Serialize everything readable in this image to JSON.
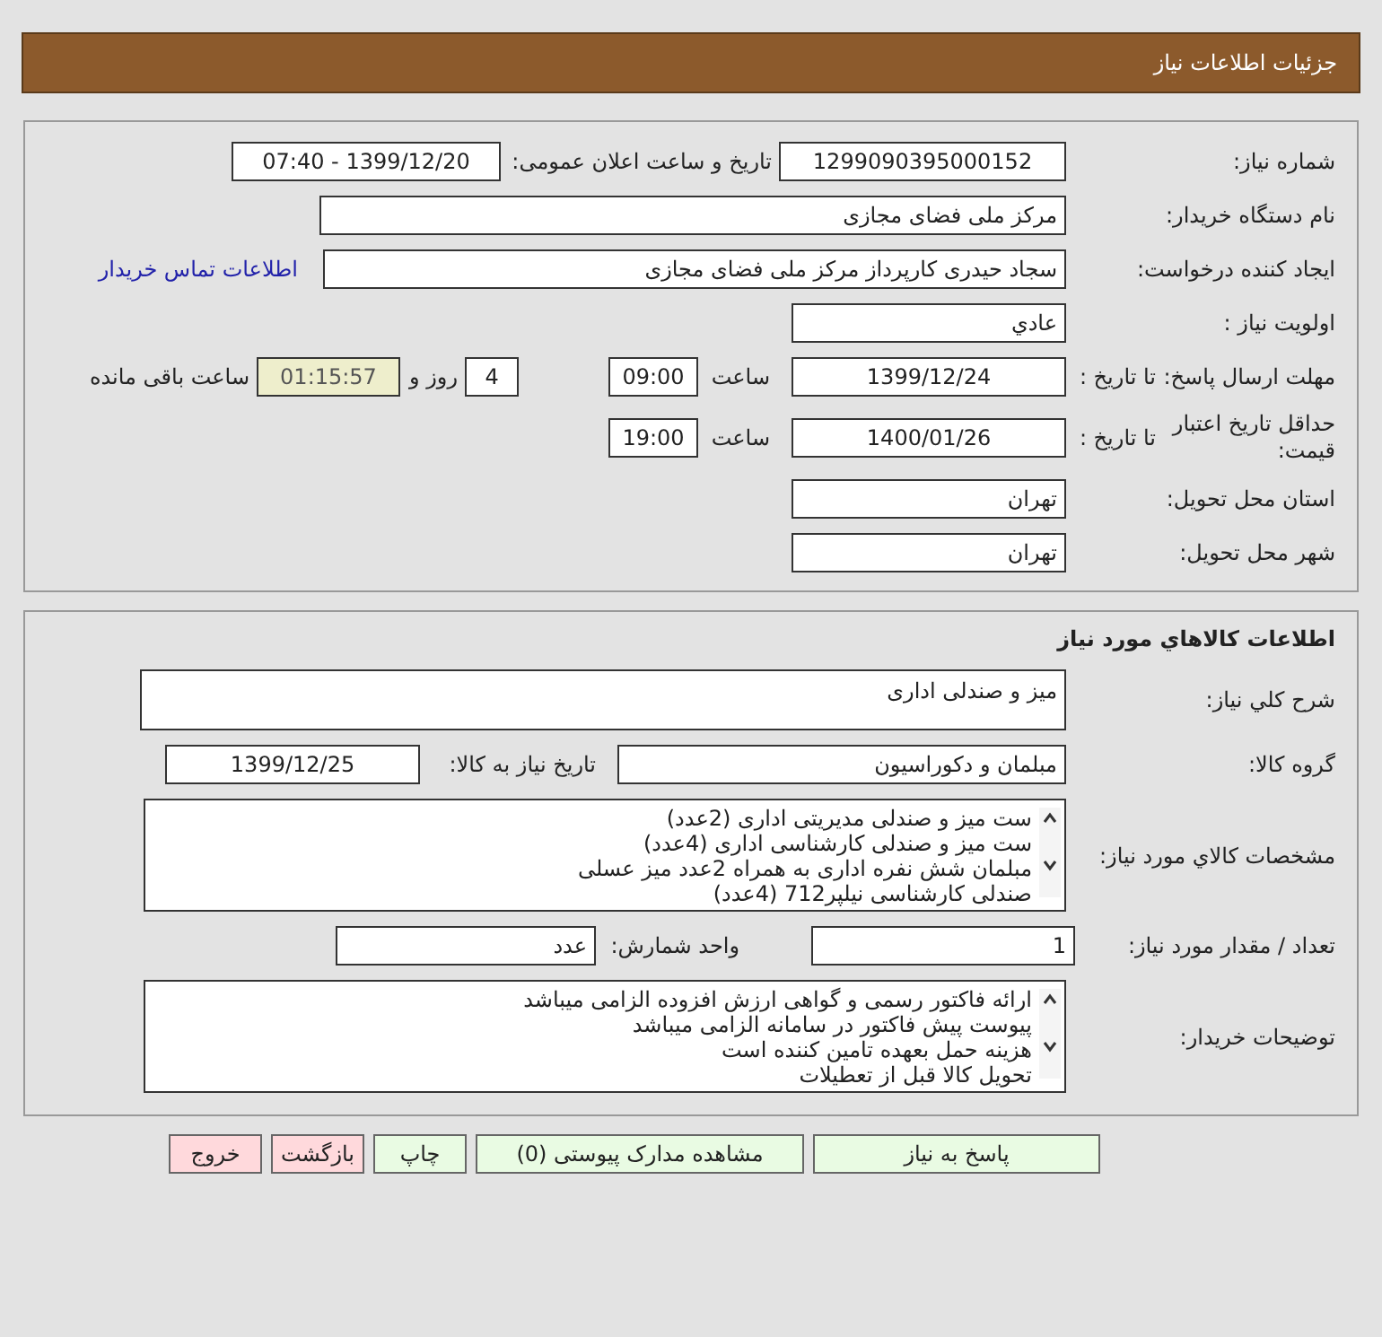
{
  "header": {
    "title": "جزئیات اطلاعات نیاز"
  },
  "request": {
    "number": {
      "label": "شماره نیاز:",
      "value": "1299090395000152"
    },
    "announce": {
      "label": "تاریخ و ساعت اعلان عمومی:",
      "value": "1399/12/20 - 07:40"
    },
    "buyer": {
      "label": "نام دستگاه خریدار:",
      "value": "مرکز ملی فضای مجازی"
    },
    "creator": {
      "label": "ایجاد کننده درخواست:",
      "value": "سجاد حیدری کارپرداز مرکز ملی فضای مجازی",
      "link": "اطلاعات تماس خریدار"
    },
    "priority": {
      "label": "اولویت نیاز :",
      "value": "عادي"
    },
    "deadline": {
      "label": "مهلت ارسال پاسخ:",
      "date_label": "تا تاریخ :",
      "date": "1399/12/24",
      "time_label": "ساعت",
      "time": "09:00",
      "days": "4",
      "days_label": "روز و",
      "remaining": "01:15:57",
      "remaining_label": "ساعت باقی مانده"
    },
    "validity": {
      "label": "حداقل تاریخ اعتبار قیمت:",
      "date_label": "تا تاریخ :",
      "date": "1400/01/26",
      "time_label": "ساعت",
      "time": "19:00"
    },
    "province": {
      "label": "استان محل تحویل:",
      "value": "تهران"
    },
    "city": {
      "label": "شهر محل تحویل:",
      "value": "تهران"
    }
  },
  "items": {
    "title": "اطلاعات کالاهاي مورد نياز",
    "summary": {
      "label": "شرح كلي نياز:",
      "value": "میز و صندلی اداری"
    },
    "group": {
      "label": "گروه کالا:",
      "value": "مبلمان و دکوراسیون",
      "date_label": "تاریخ نیاز به کالا:",
      "date": "1399/12/25"
    },
    "specs": {
      "label": "مشخصات كالاي مورد نياز:",
      "value": "ست میز و صندلی مدیریتی اداری (2عدد)\nست میز و صندلی کارشناسی اداری (4عدد)\nمبلمان شش نفره اداری به همراه 2عدد میز عسلی\nصندلی کارشناسی نیلپر712 (4عدد)"
    },
    "quantity": {
      "label": "تعداد / مقدار مورد نیاز:",
      "value": "1",
      "unit_label": "واحد شمارش:",
      "unit": "عدد"
    },
    "notes": {
      "label": "توضیحات خریدار:",
      "value": "ارائه فاکتور رسمی و گواهی ارزش افزوده الزامی میباشد\nپیوست پیش فاکتور در سامانه الزامی میباشد\nهزینه حمل بعهده تامین کننده است\nتحویل کالا قبل از تعطیلات"
    }
  },
  "buttons": [
    {
      "label": "پاسخ به نیاز",
      "kind": "primary"
    },
    {
      "label": "مشاهده مدارک پیوستی (0)",
      "kind": "primary"
    },
    {
      "label": "چاپ",
      "kind": "primary"
    },
    {
      "label": "بازگشت",
      "kind": "danger"
    },
    {
      "label": "خروج",
      "kind": "danger"
    }
  ]
}
